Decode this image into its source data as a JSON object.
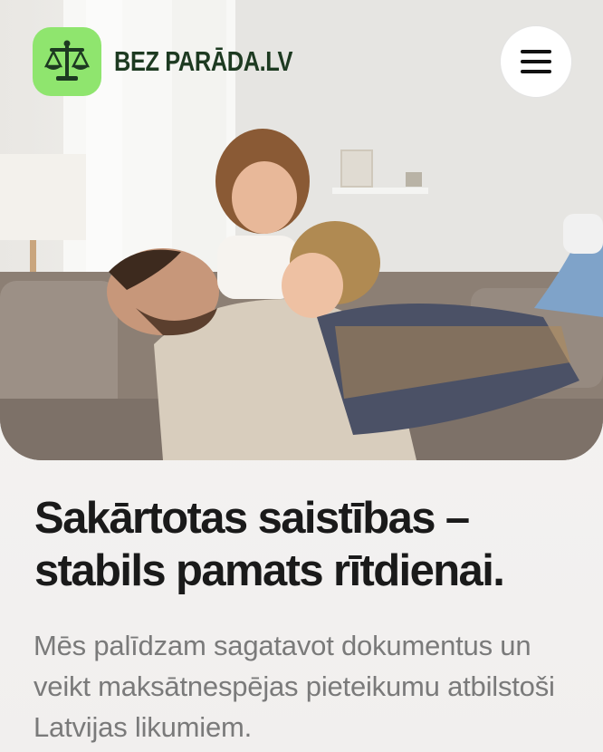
{
  "header": {
    "brand_name": "BEZ PARĀDA.LV",
    "logo_icon": "scales-icon",
    "menu_icon": "hamburger-menu-icon"
  },
  "hero": {
    "image_subject": "family-photo"
  },
  "main": {
    "headline": "Sakārtotas saistības – stabils pamats rītdienai.",
    "lead": "Mēs palīdzam sagatavot dokumentus un veikt maksātnespējas pieteikumu atbilstoši Latvijas likumiem."
  },
  "colors": {
    "accent_green": "#8fe56e",
    "brand_dark_green": "#1d3a21",
    "headline": "#1a1a1a",
    "body_text": "#7a7a7a"
  }
}
